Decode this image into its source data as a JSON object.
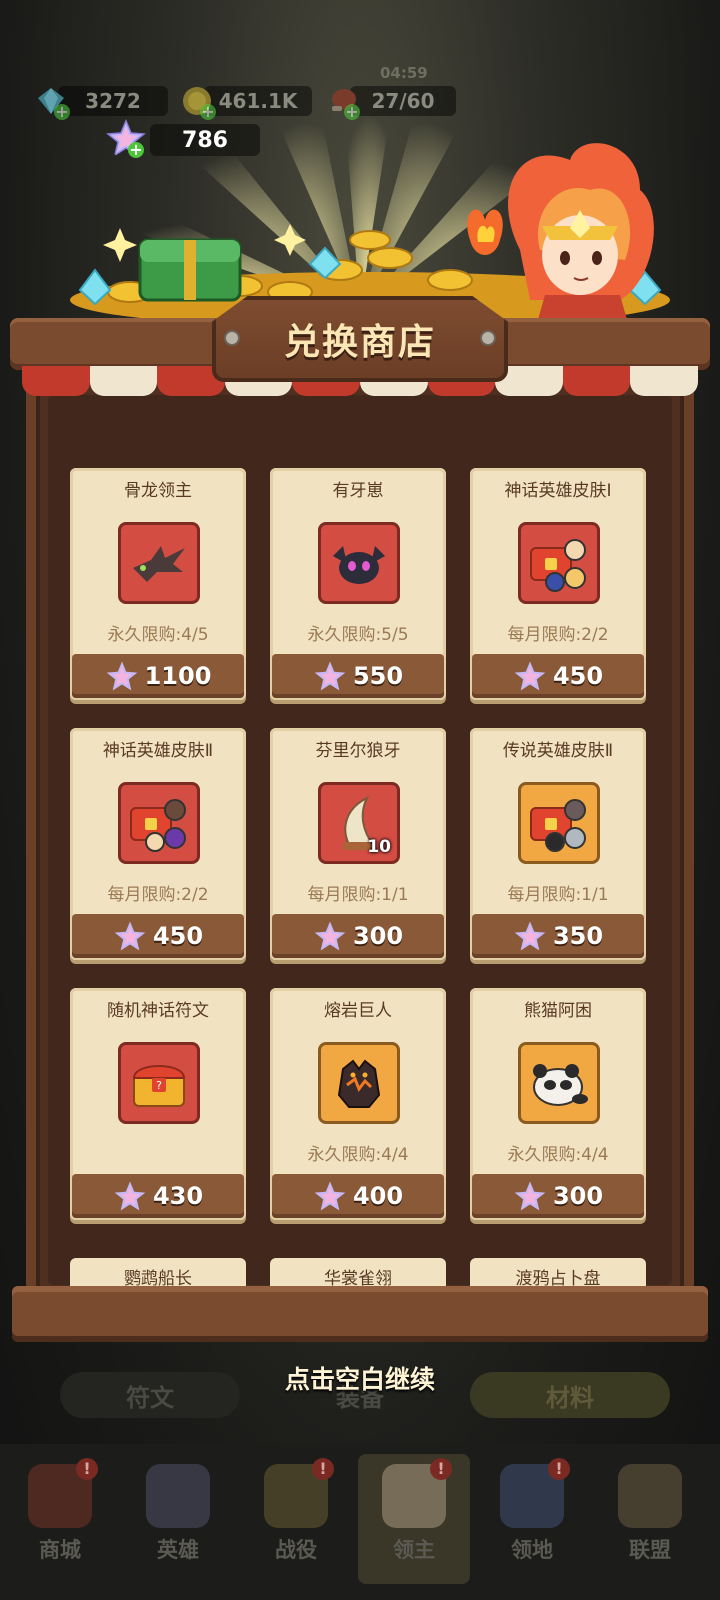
{
  "header": {
    "currencies": [
      {
        "name": "diamonds",
        "value": "3272",
        "icon": "diamond-icon",
        "color": "#5fc4d9"
      },
      {
        "name": "gold",
        "value": "461.1K",
        "icon": "gold-coin-icon",
        "color": "#e8b530"
      },
      {
        "name": "stamina",
        "value": "27/60",
        "icon": "meat-icon",
        "color": "#c9553d"
      }
    ],
    "timer": "04:59",
    "star_currency": {
      "value": "786",
      "icon": "star-crystal-icon"
    }
  },
  "shop": {
    "title": "兑换商店",
    "items": [
      {
        "name": "骨龙领主",
        "limit": "永久限购:4/5",
        "price": "1100",
        "icon": "bone-dragon-icon",
        "frame": "red"
      },
      {
        "name": "有牙崽",
        "limit": "永久限购:5/5",
        "price": "550",
        "icon": "black-dragon-pet-icon",
        "frame": "red"
      },
      {
        "name": "神话英雄皮肤Ⅰ",
        "limit": "每月限购:2/2",
        "price": "450",
        "icon": "skin-chest-icon",
        "frame": "red"
      },
      {
        "name": "神话英雄皮肤Ⅱ",
        "limit": "每月限购:2/2",
        "price": "450",
        "icon": "skin-chest-icon",
        "frame": "red"
      },
      {
        "name": "芬里尔狼牙",
        "limit": "每月限购:1/1",
        "price": "300",
        "icon": "wolf-fang-icon",
        "frame": "red",
        "qty": "10"
      },
      {
        "name": "传说英雄皮肤Ⅱ",
        "limit": "每月限购:1/1",
        "price": "350",
        "icon": "skin-chest-icon",
        "frame": "orange"
      },
      {
        "name": "随机神话符文",
        "limit": "",
        "price": "430",
        "icon": "rune-chest-icon",
        "frame": "red"
      },
      {
        "name": "熔岩巨人",
        "limit": "永久限购:4/4",
        "price": "400",
        "icon": "lava-golem-icon",
        "frame": "orange"
      },
      {
        "name": "熊猫阿困",
        "limit": "永久限购:4/4",
        "price": "300",
        "icon": "panda-pet-icon",
        "frame": "orange"
      }
    ],
    "partial_items": [
      "鹦鹉船长",
      "华裳雀翎",
      "渡鸦占卜盘"
    ]
  },
  "hint": "点击空白继续",
  "subtabs": [
    "符文",
    "装备",
    "材料"
  ],
  "nav": [
    {
      "label": "商城",
      "icon": "shop-icon",
      "badge": "!"
    },
    {
      "label": "英雄",
      "icon": "hero-cards-icon",
      "badge": ""
    },
    {
      "label": "战役",
      "icon": "swords-icon",
      "badge": "!"
    },
    {
      "label": "领主",
      "icon": "lord-crown-icon",
      "badge": "!"
    },
    {
      "label": "领地",
      "icon": "castle-icon",
      "badge": "!"
    },
    {
      "label": "联盟",
      "icon": "knight-helmet-icon",
      "badge": ""
    }
  ]
}
